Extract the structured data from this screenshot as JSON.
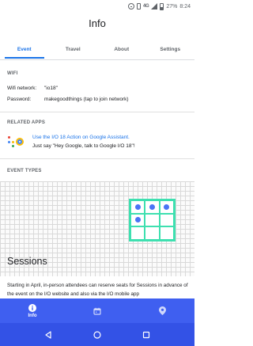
{
  "status_bar": {
    "network": "4G",
    "battery": "27%",
    "time": "8:24"
  },
  "header": {
    "title": "Info"
  },
  "tabs": [
    {
      "label": "Event",
      "active": true
    },
    {
      "label": "Travel",
      "active": false
    },
    {
      "label": "About",
      "active": false
    },
    {
      "label": "Settings",
      "active": false
    }
  ],
  "wifi": {
    "section_title": "WIFI",
    "network_label": "Wifi network:",
    "network_value": "\"io18\"",
    "password_label": "Password:",
    "password_value": "makegoodthings (tap to join network)"
  },
  "related_apps": {
    "section_title": "RELATED APPS",
    "link_text": "Use the I/O 18 Action on Google Assistant.",
    "hint_text": "Just say \"Hey Google, talk to Google I/O 18\"!"
  },
  "event_types": {
    "section_title": "EVENT TYPES",
    "grid_dots": [
      [
        true,
        true,
        true
      ],
      [
        true,
        false,
        false
      ],
      [
        false,
        false,
        false
      ]
    ]
  },
  "sessions": {
    "title": "Sessions",
    "text": "Starting in April, in-person attendees can reserve seats for Sessions in advance of the event on the I/O website and also via the I/O mobile app"
  },
  "bottom_nav": [
    {
      "label": "Info",
      "icon": "info-icon",
      "active": true
    },
    {
      "label": "",
      "icon": "calendar-icon",
      "active": false
    },
    {
      "label": "",
      "icon": "map-pin-icon",
      "active": false
    }
  ],
  "system_nav": [
    "back-icon",
    "home-icon",
    "recents-icon"
  ],
  "colors": {
    "accent": "#1a73e8",
    "nav_bar": "#3f5ff0",
    "grid_teal": "#3ee0b0",
    "dot_blue": "#4a74f5"
  }
}
